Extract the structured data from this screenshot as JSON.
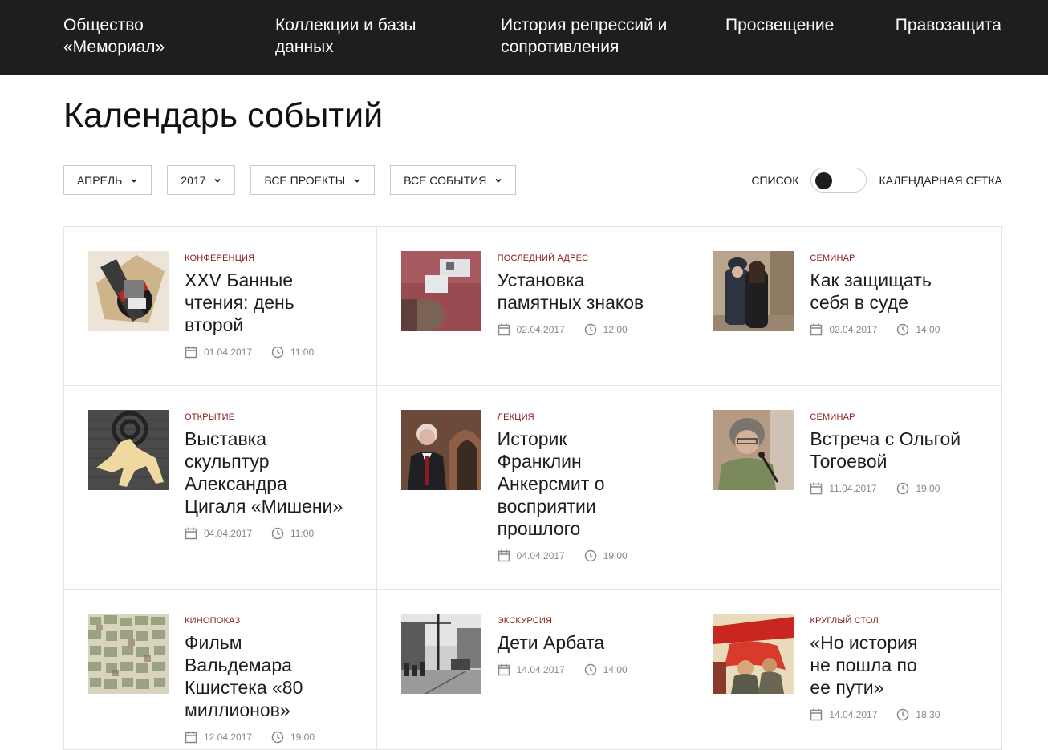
{
  "nav": {
    "items": [
      {
        "line1": "Общество",
        "line2": "«Мемориал»"
      },
      {
        "line1": "Коллекции и базы",
        "line2": "данных"
      },
      {
        "line1": "История репрессий и",
        "line2": "сопротивления"
      },
      {
        "line1": "Просвещение",
        "line2": ""
      },
      {
        "line1": "Правозащита",
        "line2": ""
      }
    ]
  },
  "page": {
    "title": "Календарь событий"
  },
  "filters": {
    "month": "АПРЕЛЬ",
    "year": "2017",
    "projects": "ВСЕ ПРОЕКТЫ",
    "events": "ВСЕ СОБЫТИЯ"
  },
  "view_toggle": {
    "left_label": "СПИСОК",
    "right_label": "КАЛЕНДАРНАЯ СЕТКА",
    "state": "list"
  },
  "icons": {
    "date": "calendar-icon",
    "time": "clock-icon",
    "dropdown": "chevron-down-icon"
  },
  "colors": {
    "nav_bg": "#1f1e1c",
    "category": "#8b1a1a",
    "meta": "#888888"
  },
  "events": [
    {
      "category": "КОНФЕРЕНЦИЯ",
      "title_lines": [
        "XXV Банные",
        "чтения: день",
        "второй"
      ],
      "date": "01.04.2017",
      "time": "11:00"
    },
    {
      "category": "ПОСЛЕДНИЙ АДРЕС",
      "title_lines": [
        "Установка",
        "памятных знаков"
      ],
      "date": "02.04.2017",
      "time": "12:00"
    },
    {
      "category": "СЕМИНАР",
      "title_lines": [
        "Как защищать",
        "себя в суде"
      ],
      "date": "02.04.2017",
      "time": "14:00"
    },
    {
      "category": "ОТКРЫТИЕ",
      "title_lines": [
        "Выставка",
        "скульптур",
        "Александра",
        "Цигаля «Мишени»"
      ],
      "date": "04.04.2017",
      "time": "11:00"
    },
    {
      "category": "ЛЕКЦИЯ",
      "title_lines": [
        "Историк",
        "Франклин",
        "Анкерсмит о",
        "восприятии",
        "прошлого"
      ],
      "date": "04.04.2017",
      "time": "19:00"
    },
    {
      "category": "СЕМИНАР",
      "title_lines": [
        "Встреча с Ольгой",
        "Тогоевой"
      ],
      "date": "11.04.2017",
      "time": "19:00"
    },
    {
      "category": "КИНОПОКАЗ",
      "title_lines": [
        "Фильм",
        "Вальдемара",
        "Кшистека «80",
        "миллионов»"
      ],
      "date": "12.04.2017",
      "time": "19:00"
    },
    {
      "category": "ЭКСКУРСИЯ",
      "title_lines": [
        "Дети Арбата"
      ],
      "date": "14.04.2017",
      "time": "14:00"
    },
    {
      "category": "КРУГЛЫЙ СТОЛ",
      "title_lines": [
        "«Но история",
        "не пошла по",
        "ее пути»"
      ],
      "date": "14.04.2017",
      "time": "18:30"
    }
  ]
}
